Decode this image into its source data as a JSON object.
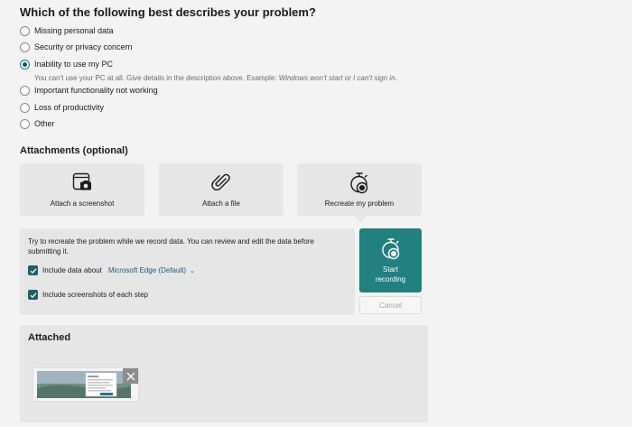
{
  "question": "Which of the following best describes your problem?",
  "options": [
    "Missing personal data",
    "Security or privacy concern",
    "Inability to use my PC",
    "Important functionality not working",
    "Loss of productivity",
    "Other"
  ],
  "selected_option": "Inability to use my PC",
  "hint_text": "You can't use your PC at all. Give details in the description above. Example: ",
  "hint_example": "Windows won't start or I can't sign in.",
  "attachments": {
    "title": "Attachments (optional)",
    "cards": [
      {
        "label": "Attach a screenshot",
        "icon": "screenshot-icon"
      },
      {
        "label": "Attach a file",
        "icon": "paperclip-icon"
      },
      {
        "label": "Recreate my problem",
        "icon": "stopwatch-record-icon"
      }
    ]
  },
  "recording": {
    "instructions": "Try to recreate the problem while we record data. You can review and edit the data before submitting it.",
    "include_data_label": "Include data about",
    "browser_value": "Microsoft Edge (Default)",
    "include_screenshots_label": "Include screenshots of each step",
    "start_label": "Start\nrecording",
    "cancel_label": "Cancel"
  },
  "attached": {
    "title": "Attached"
  },
  "colors": {
    "accent": "#22807f",
    "checkbox": "#1f5e6b",
    "link": "#1f5a7a"
  }
}
